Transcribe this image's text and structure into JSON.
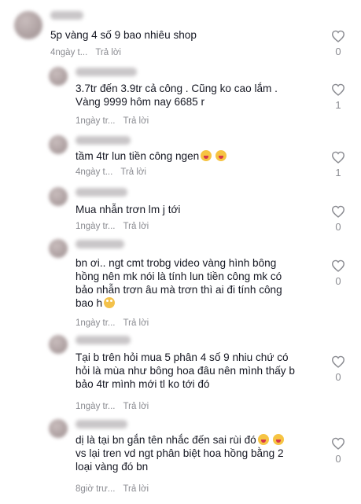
{
  "comments": [
    {
      "text": "5p vàng 4 số 9 bao nhiêu shop",
      "time": "4ngày t...",
      "reply": "Trả lời",
      "likes": "0"
    },
    {
      "text": "3.7tr đến 3.9tr cả công . Cũng ko cao lắm .\nVàng 9999 hôm nay 6685 r",
      "time": "1ngày tr...",
      "reply": "Trả lời",
      "likes": "1"
    },
    {
      "text": "tầm 4tr lun tiền công ngen",
      "time": "4ngày t...",
      "reply": "Trả lời",
      "likes": "1"
    },
    {
      "text": "Mua nhẫn trơn lm j tới",
      "time": "1ngày tr...",
      "reply": "Trả lời",
      "likes": "0"
    },
    {
      "text": "bn ơi.. ngt cmt trobg video vàng hình bông\nhồng nên mk nói là tính lun tiền công mk có\nbảo nhẫn trơn âu mà trơn thì ai đi tính công\nbao h",
      "time": "1ngày tr...",
      "reply": "Trả lời",
      "likes": "0"
    },
    {
      "text": "Tại b trên hỏi mua 5 phân 4 số 9 nhiu chứ có\nhỏi là mùa như bông hoa đâu nên mình thấy b\nbảo 4tr mình mới tl ko tới đó",
      "time": "1ngày tr...",
      "reply": "Trả lời",
      "likes": "0"
    },
    {
      "text": "dị là tại bn gắn tên nhắc đến sai rùi đó",
      "text2": "\nvs lại tren vd ngt phân biệt hoa hồng bằng 2\nloại vàng đó bn",
      "time": "8giờ trư...",
      "reply": "Trả lời",
      "likes": "0"
    }
  ],
  "icons": {
    "like": "heart-outline-icon",
    "emoji_laugh": "grinning-tongue-emoji",
    "emoji_roll": "eye-roll-emoji"
  },
  "colors": {
    "text": "#161823",
    "meta": "#8a8b91",
    "icon": "#8a8b91"
  }
}
